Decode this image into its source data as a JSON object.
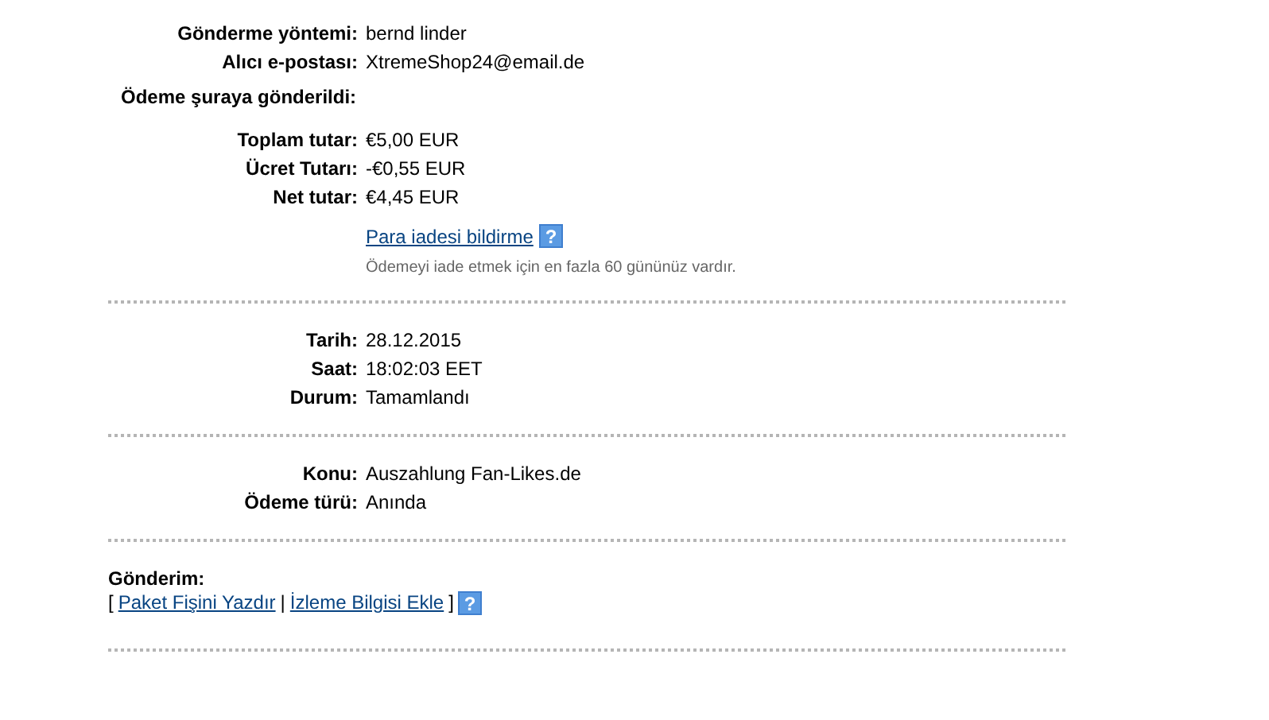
{
  "sections": [
    {
      "groups": [
        [
          {
            "kind": "pair",
            "label": "Gönderme yöntemi:",
            "value": "bernd linder"
          },
          {
            "kind": "pair",
            "label": "Alıcı e-postası:",
            "value": "XtremeShop24@email.de"
          },
          {
            "kind": "heading",
            "label": "Ödeme şuraya gönderildi:"
          }
        ],
        [
          {
            "kind": "pair",
            "label": "Toplam tutar:",
            "value": "€5,00 EUR"
          },
          {
            "kind": "pair",
            "label": "Ücret Tutarı:",
            "value": "-€0,55 EUR"
          },
          {
            "kind": "pair",
            "label": "Net tutar:",
            "value": "€4,45 EUR"
          },
          {
            "kind": "link",
            "value": "Para iadesi bildirme",
            "help": "?"
          },
          {
            "kind": "note",
            "value": "Ödemeyi iade etmek için en fazla 60 gününüz vardır."
          }
        ]
      ]
    },
    {
      "groups": [
        [
          {
            "kind": "pair",
            "label": "Tarih:",
            "value": "28.12.2015"
          },
          {
            "kind": "pair",
            "label": "Saat:",
            "value": "18:02:03 EET"
          },
          {
            "kind": "pair",
            "label": "Durum:",
            "value": "Tamamlandı"
          }
        ]
      ]
    },
    {
      "groups": [
        [
          {
            "kind": "pair",
            "label": "Konu:",
            "value": "Auszahlung Fan-Likes.de"
          },
          {
            "kind": "pair",
            "label": "Ödeme türü:",
            "value": "Anında"
          }
        ]
      ]
    }
  ],
  "shipping": {
    "title": "Gönderim:",
    "open": "[",
    "links": [
      "Paket Fişini Yazdır",
      "İzleme Bilgisi Ekle"
    ],
    "separator": "|",
    "close": "]",
    "help": "?"
  }
}
